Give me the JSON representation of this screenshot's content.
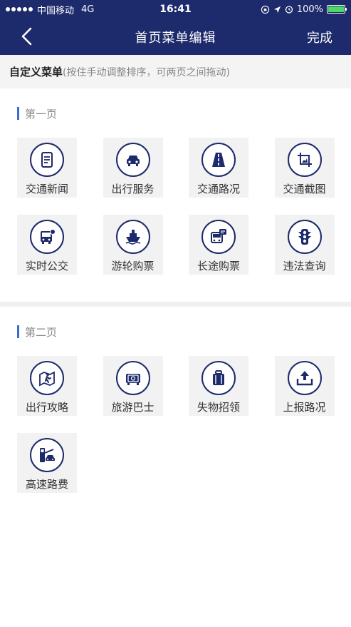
{
  "status_bar": {
    "carrier": "中国移动",
    "network": "4G",
    "time": "16:41",
    "battery": "100%"
  },
  "nav": {
    "title": "首页菜单编辑",
    "done_label": "完成"
  },
  "hint": {
    "title": "自定义菜单",
    "subtitle": "(按住手动调整排序，可两页之间拖动)"
  },
  "pages": [
    {
      "title": "第一页",
      "items": [
        {
          "label": "交通新闻",
          "icon": "news-icon"
        },
        {
          "label": "出行服务",
          "icon": "car-icon"
        },
        {
          "label": "交通路况",
          "icon": "road-icon"
        },
        {
          "label": "交通截图",
          "icon": "crop-image-icon"
        },
        {
          "label": "实时公交",
          "icon": "bus-icon"
        },
        {
          "label": "游轮购票",
          "icon": "ship-icon"
        },
        {
          "label": "长途购票",
          "icon": "coach-icon"
        },
        {
          "label": "违法查询",
          "icon": "traffic-light-icon"
        }
      ]
    },
    {
      "title": "第二页",
      "items": [
        {
          "label": "出行攻略",
          "icon": "travel-guide-icon"
        },
        {
          "label": "旅游巴士",
          "icon": "tour-bus-icon"
        },
        {
          "label": "失物招领",
          "icon": "luggage-icon"
        },
        {
          "label": "上报路况",
          "icon": "upload-icon"
        },
        {
          "label": "高速路费",
          "icon": "toll-icon"
        }
      ]
    }
  ],
  "colors": {
    "nav_bg": "#1d2a6b",
    "accent_bar": "#3a6cd3",
    "tile_bg": "#f2f2f2",
    "battery": "#4cd964"
  }
}
